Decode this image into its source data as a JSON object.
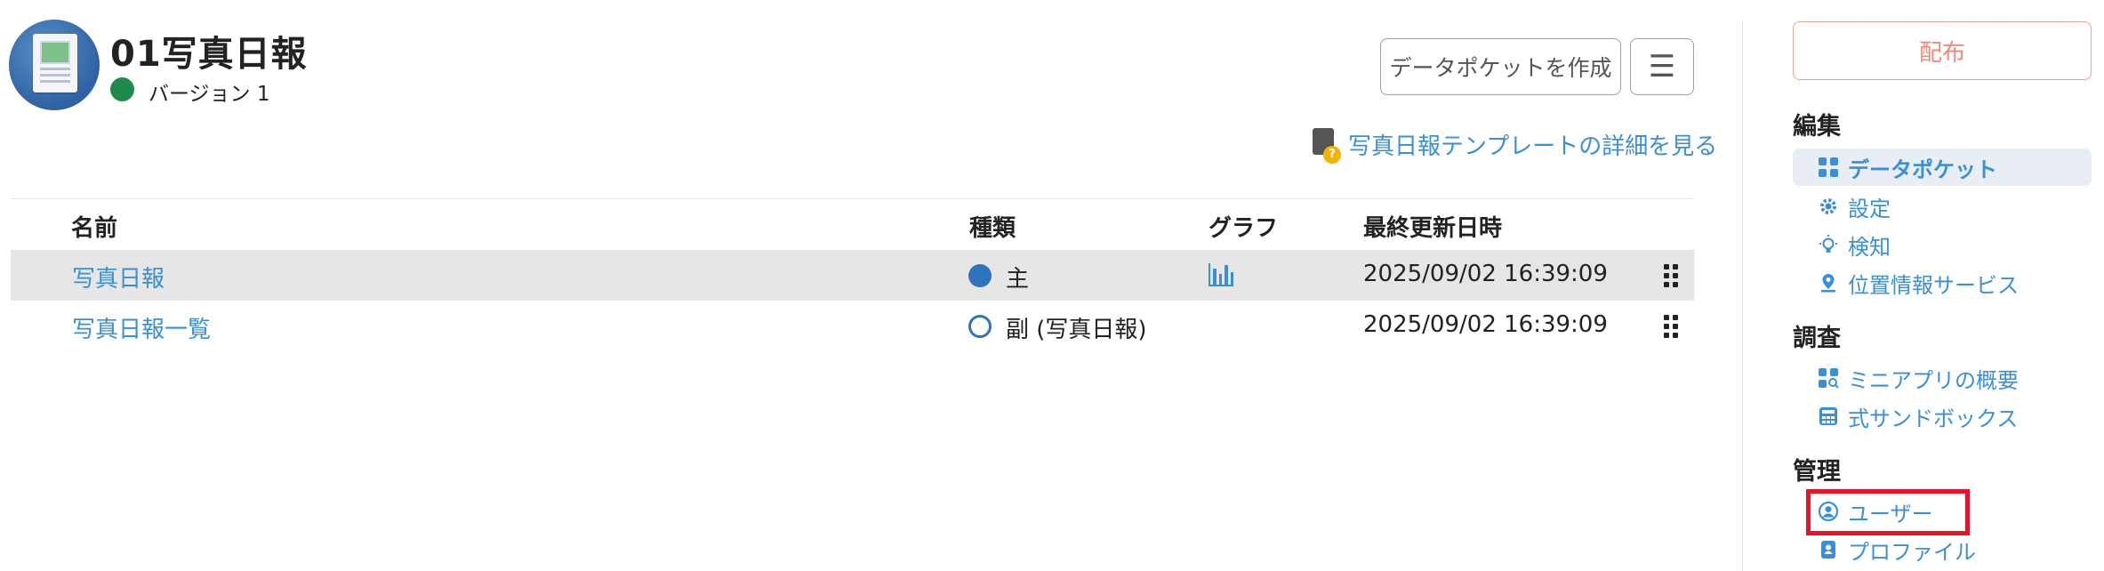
{
  "header": {
    "title": "01写真日報",
    "version_label": "バージョン 1",
    "create_button": "データポケットを作成",
    "menu_icon": "☰",
    "template_link": "写真日報テンプレートの詳細を見る"
  },
  "table": {
    "columns": {
      "name": "名前",
      "type": "種類",
      "graph": "グラフ",
      "updated": "最終更新日時"
    },
    "rows": [
      {
        "name": "写真日報",
        "type": "主",
        "has_graph": true,
        "updated": "2025/09/02 16:39:09"
      },
      {
        "name": "写真日報一覧",
        "type": "副 (写真日報)",
        "has_graph": false,
        "updated": "2025/09/02 16:39:09"
      }
    ]
  },
  "sidebar": {
    "distribute_button": "配布",
    "sections": {
      "edit": "編集",
      "survey": "調査",
      "manage": "管理"
    },
    "items": {
      "data_pocket": "データポケット",
      "settings": "設定",
      "detection": "検知",
      "location": "位置情報サービス",
      "mini_app": "ミニアプリの概要",
      "sandbox": "式サンドボックス",
      "users": "ユーザー",
      "profile": "プロファイル"
    }
  },
  "colors": {
    "accent": "#3a8fd6",
    "version_green": "#1e8a4c",
    "distribute": "#ef8a78",
    "highlight": "#e8132b"
  }
}
